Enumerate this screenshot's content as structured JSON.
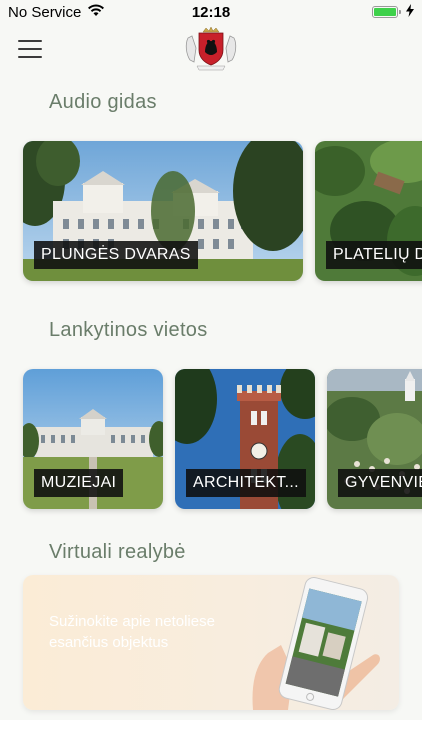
{
  "status": {
    "carrier": "No Service",
    "time": "12:18",
    "battery_percent": 100,
    "icons": [
      "wifi-icon",
      "battery-icon",
      "charging-bolt-icon"
    ]
  },
  "header": {
    "menu_icon": "hamburger-menu-icon",
    "logo": "plunge-coat-of-arms-logo"
  },
  "sections": {
    "audio": {
      "title": "Audio gidas",
      "cards": [
        {
          "label": "PLUNGĖS DVARAS"
        },
        {
          "label": "PLATELIŲ D"
        }
      ]
    },
    "places": {
      "title": "Lankytinos vietos",
      "cards": [
        {
          "label": "MUZIEJAI"
        },
        {
          "label": "ARCHITEKT..."
        },
        {
          "label": "GYVENVIET"
        }
      ]
    },
    "vr": {
      "title": "Virtuali realybė",
      "text": "Sužinokite apie netoliese esančius objektus"
    }
  },
  "colors": {
    "section_title": "#6a7d6a",
    "background": "#f7f8f5",
    "label_bg": "#0f0f0f"
  }
}
